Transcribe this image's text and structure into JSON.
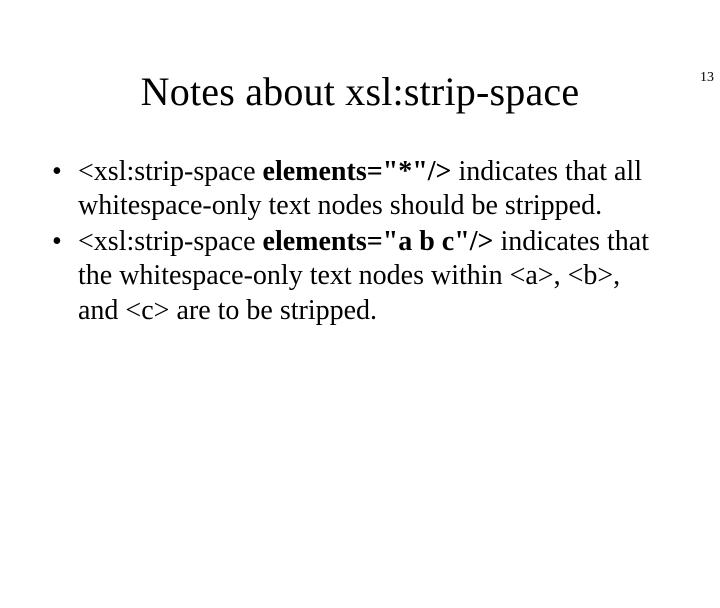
{
  "page_number": "13",
  "title": "Notes about xsl:strip-space",
  "bullets": [
    {
      "prefix": "<xsl:strip-space ",
      "bold": "elements=\"*\"/>",
      "suffix": " indicates that all whitespace-only text nodes should be stripped."
    },
    {
      "prefix": "<xsl:strip-space ",
      "bold": "elements=\"a b c\"/>",
      "suffix": " indicates that the whitespace-only text nodes within <a>, <b>, and <c> are to be stripped."
    }
  ]
}
